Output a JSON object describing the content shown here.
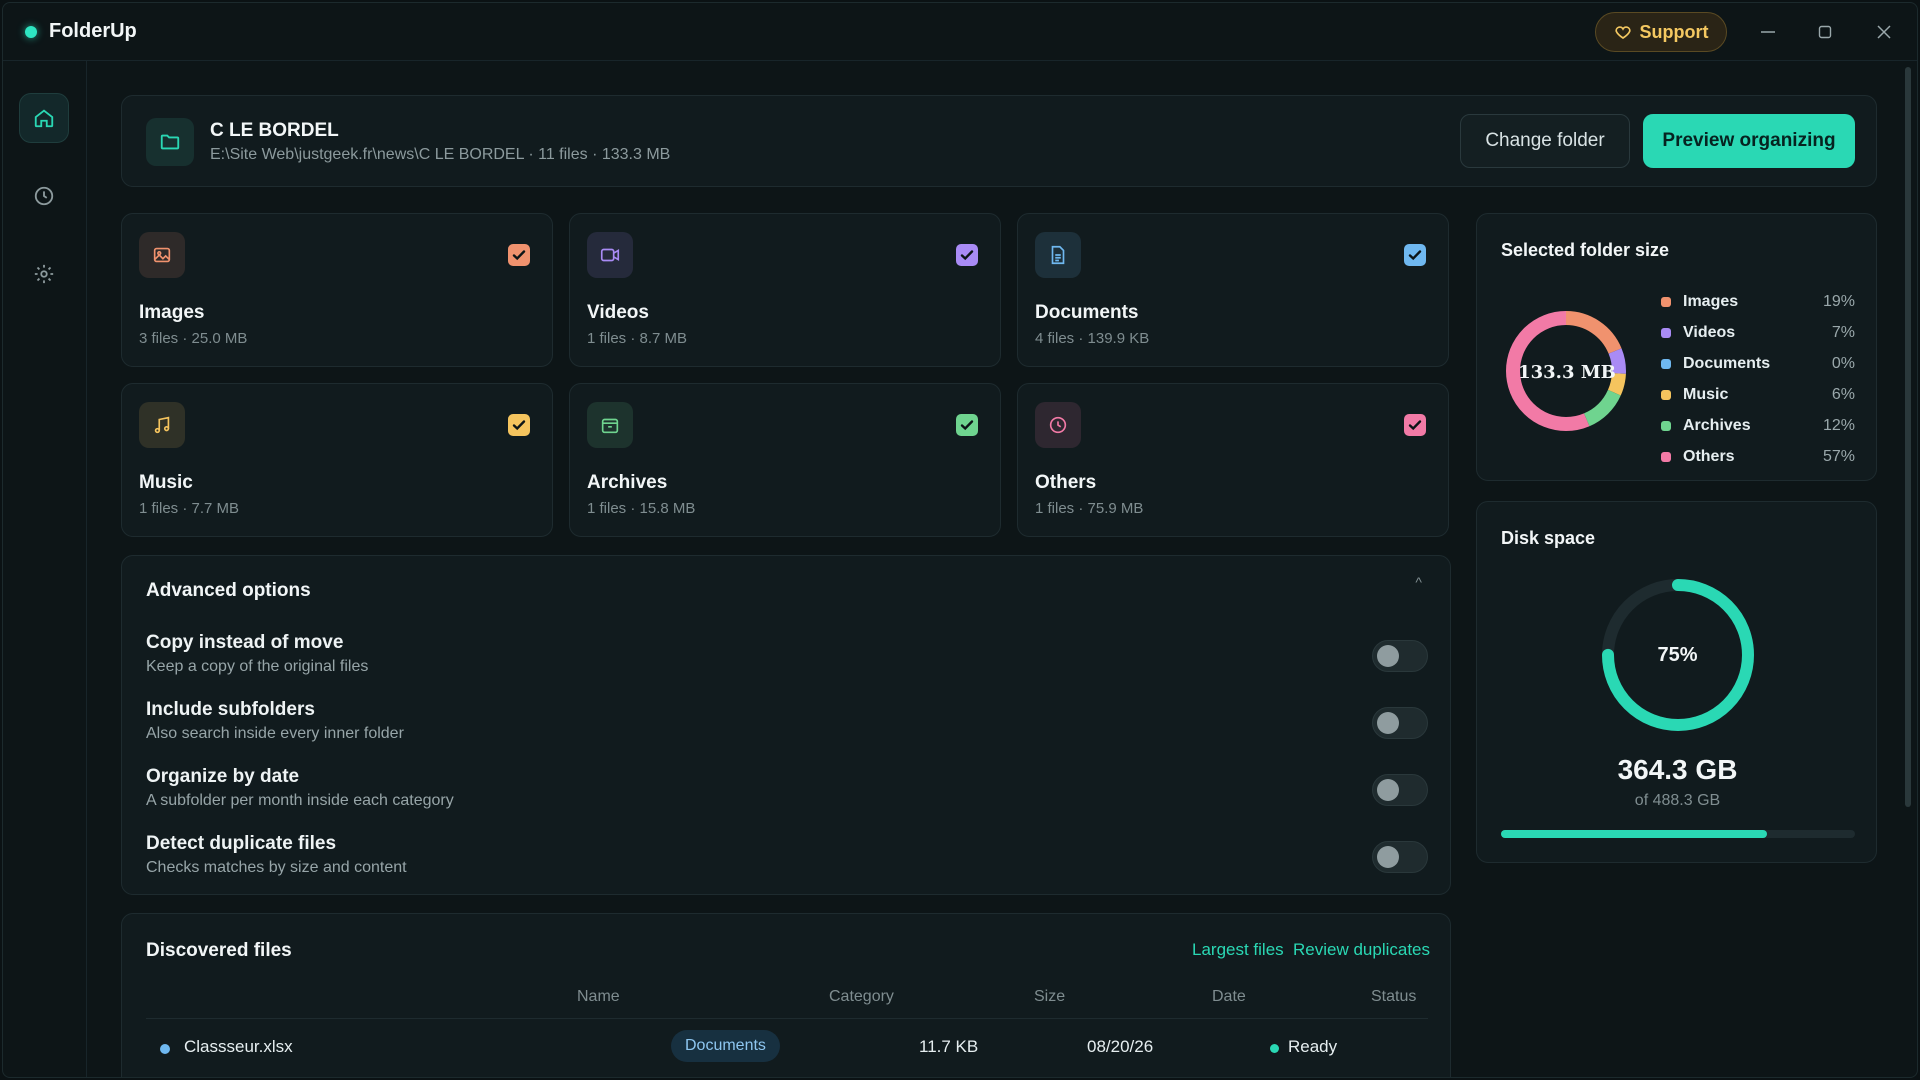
{
  "app": {
    "title": "FolderUp",
    "support_label": "Support"
  },
  "folder": {
    "name": "C LE BORDEL",
    "path": "E:\\Site Web\\justgeek.fr\\news\\C LE BORDEL · 11 files · 133.3 MB",
    "change_label": "Change folder",
    "preview_label": "Preview organizing"
  },
  "categories": [
    {
      "name": "Images",
      "meta": "3 files · 25.0 MB",
      "color": "#f0926e",
      "checked": true
    },
    {
      "name": "Videos",
      "meta": "1 files · 8.7 MB",
      "color": "#a98bf5",
      "checked": true
    },
    {
      "name": "Documents",
      "meta": "4 files · 139.9 KB",
      "color": "#6fb8f0",
      "checked": true
    },
    {
      "name": "Music",
      "meta": "1 files · 7.7 MB",
      "color": "#f5c45e",
      "checked": true
    },
    {
      "name": "Archives",
      "meta": "1 files · 15.8 MB",
      "color": "#6fd48f",
      "checked": true
    },
    {
      "name": "Others",
      "meta": "1 files · 75.9 MB",
      "color": "#f27aa6",
      "checked": true
    }
  ],
  "advanced": {
    "title": "Advanced options",
    "options": [
      {
        "title": "Copy instead of move",
        "desc": "Keep a copy of the original files",
        "on": false
      },
      {
        "title": "Include subfolders",
        "desc": "Also search inside every inner folder",
        "on": false
      },
      {
        "title": "Organize by date",
        "desc": "A subfolder per month inside each category",
        "on": false
      },
      {
        "title": "Detect duplicate files",
        "desc": "Checks matches by size and content",
        "on": false
      }
    ]
  },
  "files": {
    "title": "Discovered files",
    "largest_label": "Largest files",
    "duplicates_label": "Review duplicates",
    "columns": [
      "Name",
      "Category",
      "Size",
      "Date",
      "Status"
    ],
    "rows": [
      {
        "name": "Classseur.xlsx",
        "category": "Documents",
        "size": "11.7 KB",
        "date": "08/20/26",
        "status": "Ready"
      }
    ]
  },
  "folder_size": {
    "title": "Selected folder size",
    "total": "133.3 MB",
    "segments": [
      {
        "name": "Images",
        "pct": "19%",
        "value": 19,
        "color": "#f0926e"
      },
      {
        "name": "Videos",
        "pct": "7%",
        "value": 7,
        "color": "#a98bf5"
      },
      {
        "name": "Documents",
        "pct": "0%",
        "value": 0,
        "color": "#6fb8f0"
      },
      {
        "name": "Music",
        "pct": "6%",
        "value": 6,
        "color": "#f5c45e"
      },
      {
        "name": "Archives",
        "pct": "12%",
        "value": 12,
        "color": "#6fd48f"
      },
      {
        "name": "Others",
        "pct": "57%",
        "value": 57,
        "color": "#f27aa6"
      }
    ]
  },
  "disk": {
    "title": "Disk space",
    "pct_label": "75%",
    "fraction": 0.75,
    "used": "364.3 GB",
    "total": "of 488.3 GB"
  },
  "colors": {
    "accent": "#2ad8b4",
    "warning": "#f4c861"
  }
}
